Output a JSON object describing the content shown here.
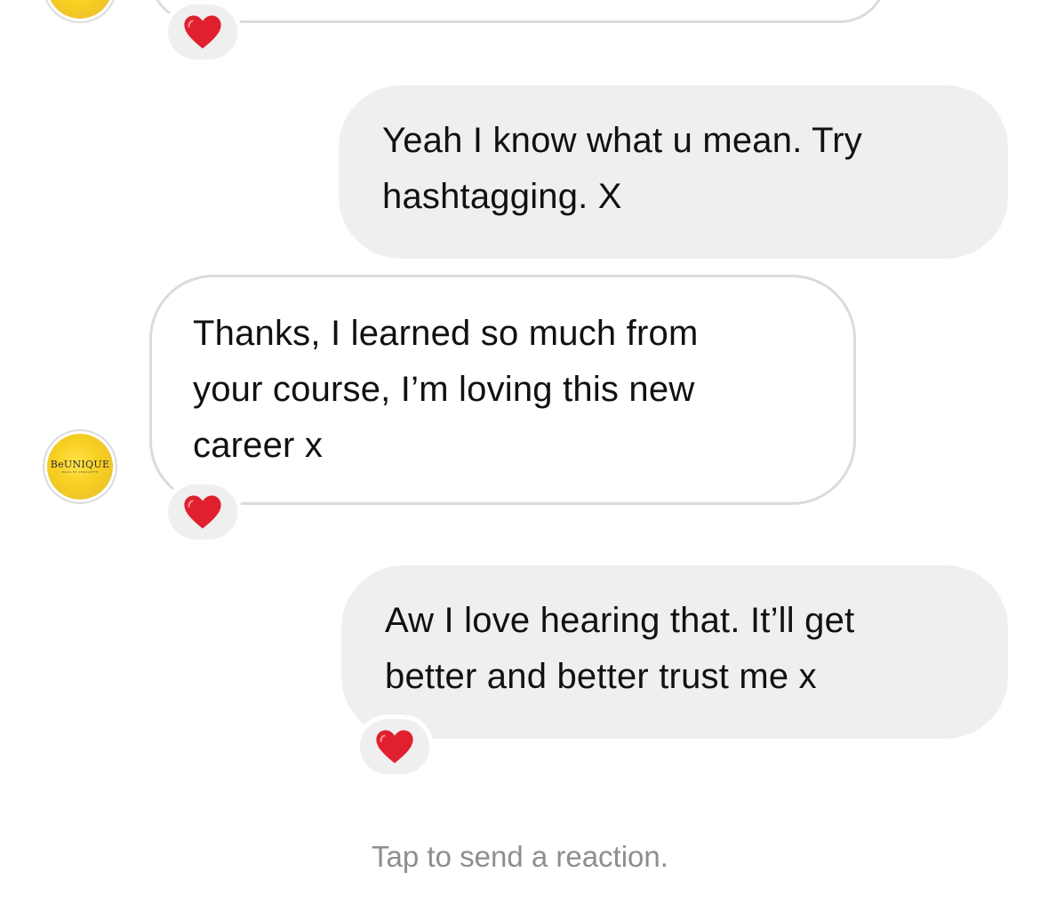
{
  "thread": {
    "messages": [
      {
        "direction": "outgoing",
        "lines": [
          "Yeah I know what u mean. Try",
          "hashtagging. X"
        ]
      },
      {
        "direction": "incoming",
        "lines": [
          "Thanks, I learned so much from",
          "your course, I’m loving this new",
          "career x"
        ],
        "reaction": "red-heart"
      },
      {
        "direction": "outgoing",
        "lines": [
          "Aw I love hearing that. It’ll get",
          "better and better trust me x"
        ],
        "reaction": "red-heart"
      }
    ],
    "previous_message_reaction": "red-heart",
    "avatar": {
      "logo_text": "BeUNIQUE",
      "sub_text": "NAILS BY CHARLOTTE"
    }
  },
  "footer": {
    "hint": "Tap to send a reaction."
  },
  "colors": {
    "outgoing_bubble": "#efefef",
    "incoming_border": "#dbdbdb",
    "heart": "#e0202e",
    "hint_text": "#8e8e8e"
  }
}
